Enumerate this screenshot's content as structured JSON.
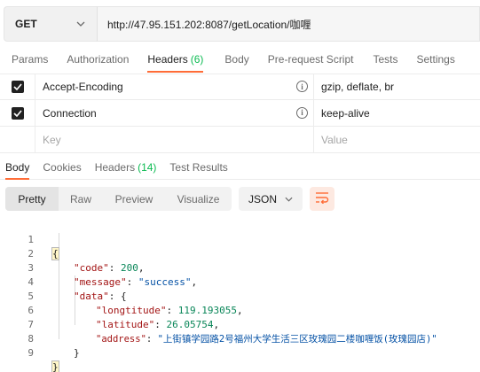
{
  "request": {
    "method": "GET",
    "url": "http://47.95.151.202:8087/getLocation/咖喱"
  },
  "request_tabs": [
    {
      "label": "Params"
    },
    {
      "label": "Authorization"
    },
    {
      "label": "Headers",
      "count": "(6)"
    },
    {
      "label": "Body"
    },
    {
      "label": "Pre-request Script"
    },
    {
      "label": "Tests"
    },
    {
      "label": "Settings"
    }
  ],
  "headers": [
    {
      "key": "Accept-Encoding",
      "value": "gzip, deflate, br"
    },
    {
      "key": "Connection",
      "value": "keep-alive"
    }
  ],
  "headers_placeholder": {
    "key": "Key",
    "value": "Value"
  },
  "response_tabs": [
    {
      "label": "Body"
    },
    {
      "label": "Cookies"
    },
    {
      "label": "Headers",
      "count": "(14)"
    },
    {
      "label": "Test Results"
    }
  ],
  "view_modes": [
    "Pretty",
    "Raw",
    "Preview",
    "Visualize"
  ],
  "format": "JSON",
  "line_numbers": [
    "1",
    "2",
    "3",
    "4",
    "5",
    "6",
    "7",
    "8",
    "9"
  ],
  "response_body": {
    "open_brace": "{",
    "close_brace": "}",
    "code_key": "\"code\"",
    "code_value": "200",
    "message_key": "\"message\"",
    "message_value": "\"success\"",
    "data_key": "\"data\"",
    "data_open": "{",
    "data_close": "}",
    "longtitude_key": "\"longtitude\"",
    "longtitude_value": "119.193055",
    "latitude_key": "\"latitude\"",
    "latitude_value": "26.05754",
    "address_key": "\"address\"",
    "address_value": "\"上街镇学园路2号福州大学生活三区玫瑰园二楼咖喱饭(玫瑰园店)\""
  },
  "colors": {
    "accent": "#ff6c37",
    "count_green": "#0cbb52",
    "json_key": "#a31515",
    "json_string": "#0451a5",
    "json_number": "#098658"
  }
}
